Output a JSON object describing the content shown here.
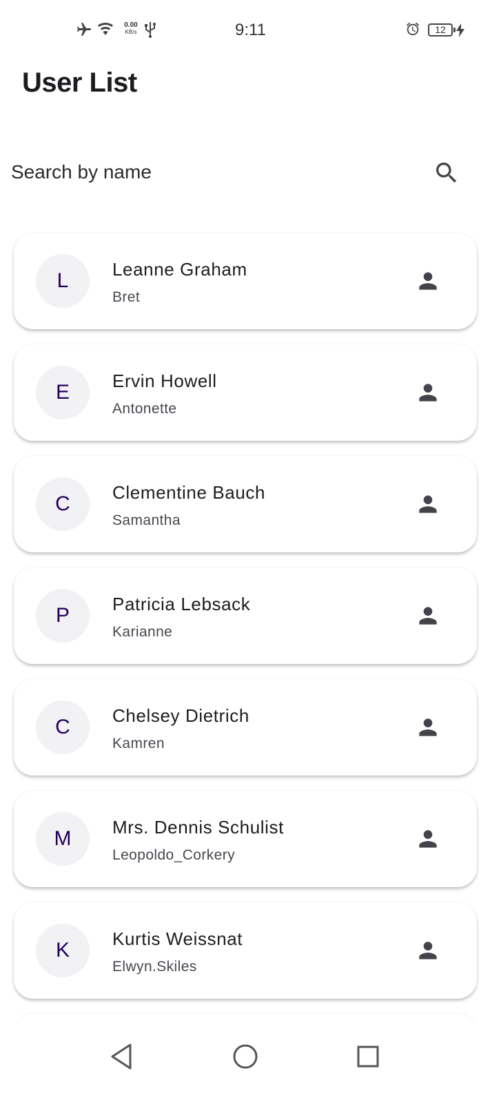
{
  "status_bar": {
    "time": "9:11",
    "net_speed_value": "0.00",
    "net_speed_unit": "KB/s",
    "battery_level": "12",
    "icons": [
      "airplane-icon",
      "wifi-icon",
      "usb-icon",
      "alarm-icon",
      "battery-icon",
      "charging-icon"
    ]
  },
  "header": {
    "title": "User List"
  },
  "search": {
    "placeholder": "Search by name",
    "value": "",
    "icon": "search-icon"
  },
  "users": [
    {
      "initial": "L",
      "name": "Leanne Graham",
      "username": "Bret"
    },
    {
      "initial": "E",
      "name": "Ervin Howell",
      "username": "Antonette"
    },
    {
      "initial": "C",
      "name": "Clementine Bauch",
      "username": "Samantha"
    },
    {
      "initial": "P",
      "name": "Patricia Lebsack",
      "username": "Karianne"
    },
    {
      "initial": "C",
      "name": "Chelsey Dietrich",
      "username": "Kamren"
    },
    {
      "initial": "M",
      "name": "Mrs. Dennis Schulist",
      "username": "Leopoldo_Corkery"
    },
    {
      "initial": "K",
      "name": "Kurtis Weissnat",
      "username": "Elwyn.Skiles"
    }
  ],
  "nav": {
    "icons": [
      "back-icon",
      "home-icon",
      "recents-icon"
    ]
  },
  "colors": {
    "avatar_bg": "#f2f1f4",
    "avatar_text": "#21005d",
    "icon": "#44434a"
  }
}
